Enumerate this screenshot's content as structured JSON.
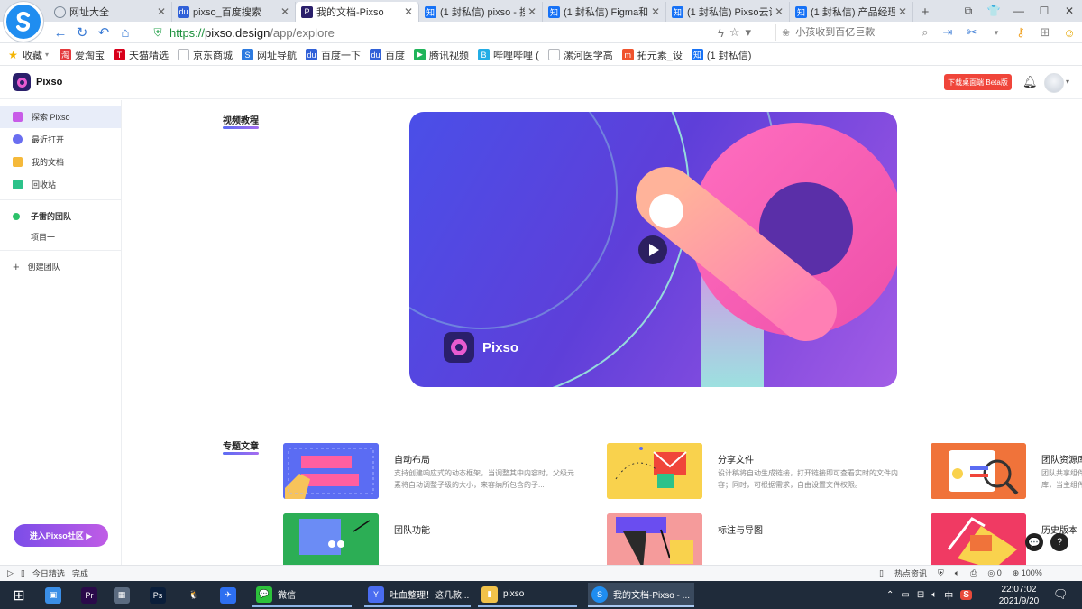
{
  "browser": {
    "tabs": [
      {
        "title": "网址大全",
        "icon": "globe-icon",
        "color": "#7a8796",
        "active": false
      },
      {
        "title": "pixso_百度搜索",
        "icon": "baidu-paw-icon",
        "color": "#3161d8",
        "active": false
      },
      {
        "title": "我的文档-Pixso",
        "icon": "pixso-icon",
        "color": "#2a1f6b",
        "active": true
      },
      {
        "title": "(1 封私信) pixso - 搜",
        "icon": "zhihu-icon",
        "color": "#1772f6",
        "active": false
      },
      {
        "title": "(1 封私信) Figma和Pi",
        "icon": "zhihu-icon",
        "color": "#1772f6",
        "active": false
      },
      {
        "title": "(1 封私信) Pixso云设",
        "icon": "zhihu-icon",
        "color": "#1772f6",
        "active": false
      },
      {
        "title": "(1 封私信) 产品经理可",
        "icon": "zhihu-icon",
        "color": "#1772f6",
        "active": false
      }
    ],
    "tab_icon_text": {
      "zhihu": "知",
      "pixso": "P",
      "baidu": "du"
    },
    "new_tab_label": "+",
    "window_controls": [
      "⧉",
      "👕",
      "—",
      "☐",
      "✕"
    ],
    "url": {
      "protocol": "https://",
      "host": "pixso.design",
      "path": "/app/explore"
    },
    "search_placeholder": "小孩收到百亿巨款",
    "bookmarks": [
      {
        "label": "收藏",
        "color": "#f4b400",
        "glyph": "★"
      },
      {
        "label": "爱淘宝",
        "color": "#e4393c",
        "glyph": "淘"
      },
      {
        "label": "天猫精选",
        "color": "#d8001b",
        "glyph": "T"
      },
      {
        "label": "京东商城",
        "color": "#b5b8bd",
        "glyph": ""
      },
      {
        "label": "网址导航",
        "color": "#2d7be0",
        "glyph": "S"
      },
      {
        "label": "百度一下",
        "color": "#3161d8",
        "glyph": "du"
      },
      {
        "label": "百度",
        "color": "#3161d8",
        "glyph": "du"
      },
      {
        "label": "腾讯视频",
        "color": "#20b45a",
        "glyph": "▶"
      },
      {
        "label": "哔哩哔哩 (",
        "color": "#23ade5",
        "glyph": "B"
      },
      {
        "label": "漯河医学高",
        "color": "#b5b8bd",
        "glyph": ""
      },
      {
        "label": "拓元素_设",
        "color": "#f0532d",
        "glyph": "m"
      },
      {
        "label": "(1 封私信)",
        "color": "#1772f6",
        "glyph": "知"
      }
    ]
  },
  "app": {
    "name": "Pixso",
    "download_label": "下载桌面端 Beta版",
    "sidebar": {
      "items": [
        {
          "label": "探索 Pixso",
          "icon": "explore-icon",
          "color": "#c85ce8",
          "active": true
        },
        {
          "label": "最近打开",
          "icon": "clock-icon",
          "color": "#6a6ef0"
        },
        {
          "label": "我的文档",
          "icon": "document-icon",
          "color": "#f5b93a"
        },
        {
          "label": "回收站",
          "icon": "trash-icon",
          "color": "#2cc28a"
        }
      ],
      "team": {
        "label": "子雷的团队",
        "color": "#2cc26a"
      },
      "project": "项目一",
      "create_team": "创建团队",
      "create_team_glyph": "+",
      "community_label": "进入Pixso社区 ▶"
    },
    "video_section_title": "视频教程",
    "article_section_title": "专题文章",
    "articles": [
      {
        "title": "自动布局",
        "desc": "支持创建响应式的动态框架，当调整其中内容时，父级元素将自动调整子级的大小，来容纳所包含的子...",
        "bg": "#5b6cf3"
      },
      {
        "title": "分享文件",
        "desc": "设计稿将自动生成链接，打开链接即可查看实时的文件内容；同时，可根据需求，自由设置文件权限。",
        "bg": "#f9d24d"
      },
      {
        "title": "团队资源库",
        "desc": "团队共享组件库，当主组件修改...",
        "bg": "#f0733a"
      },
      {
        "title": "团队功能",
        "desc": "",
        "bg": "#2cae55"
      },
      {
        "title": "标注与导图",
        "desc": "",
        "bg": "#f59b9b"
      },
      {
        "title": "历史版本",
        "desc": "",
        "bg": "#f03a63"
      }
    ],
    "float_buttons": [
      "💬",
      "?"
    ]
  },
  "statusbar": {
    "left": [
      "今日精选",
      "完成"
    ],
    "right": [
      "热点资讯",
      "0",
      "100%"
    ]
  },
  "taskbar": {
    "apps": [
      {
        "label": "",
        "icon": "windows-start-icon",
        "color": "#1f2b3a",
        "glyph": "⊞"
      },
      {
        "label": "",
        "icon": "computer-icon",
        "color": "#3a8ee6",
        "glyph": "▣"
      },
      {
        "label": "",
        "icon": "premiere-icon",
        "color": "#2a0a4a",
        "glyph": "Pr"
      },
      {
        "label": "",
        "icon": "calculator-icon",
        "color": "#5b6b80",
        "glyph": "▦"
      },
      {
        "label": "",
        "icon": "photoshop-icon",
        "color": "#0a1e3a",
        "glyph": "Ps"
      },
      {
        "label": "",
        "icon": "qq-icon",
        "color": "#1f2b3a",
        "glyph": "🐧"
      },
      {
        "label": "",
        "icon": "feishu-icon",
        "color": "#2d6ff0",
        "glyph": "✈"
      },
      {
        "label": "微信",
        "icon": "wechat-icon",
        "color": "#2cc23b",
        "glyph": "💬"
      },
      {
        "label": "吐血整理！这几款...",
        "icon": "browser-icon",
        "color": "#4a6cf0",
        "glyph": "Y"
      },
      {
        "label": "pixso",
        "icon": "folder-icon",
        "color": "#f1c24a",
        "glyph": "▮"
      },
      {
        "label": "我的文档-Pixso - ...",
        "icon": "sogou-browser-icon",
        "color": "#1f8df0",
        "glyph": "S"
      }
    ],
    "tray_ime": "中",
    "tray_s": "S",
    "time": "22:07:02",
    "date": "2021/9/20"
  },
  "colors": {
    "accent": "#5b6cf3",
    "danger": "#f0453a",
    "purple": "#7b4de8"
  }
}
